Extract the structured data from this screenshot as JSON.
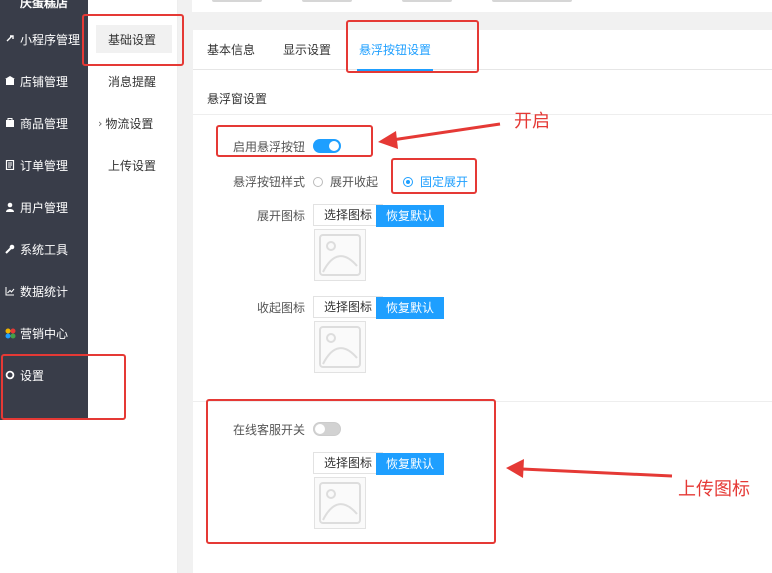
{
  "sidebar": {
    "brand": "庆蛋糕店",
    "items": [
      {
        "label": "小程序管理",
        "icon": "link-icon"
      },
      {
        "label": "店铺管理",
        "icon": "store-icon"
      },
      {
        "label": "商品管理",
        "icon": "goods-icon"
      },
      {
        "label": "订单管理",
        "icon": "order-icon"
      },
      {
        "label": "用户管理",
        "icon": "user-icon"
      },
      {
        "label": "系统工具",
        "icon": "wrench-icon"
      },
      {
        "label": "数据统计",
        "icon": "chart-icon"
      },
      {
        "label": "营销中心",
        "icon": "marketing-icon"
      },
      {
        "label": "设置",
        "icon": "gear-icon"
      }
    ]
  },
  "submenu": {
    "items": [
      {
        "label": "基础设置",
        "active": true
      },
      {
        "label": "消息提醒"
      },
      {
        "label": "物流设置",
        "expandable": true
      },
      {
        "label": "上传设置"
      }
    ]
  },
  "tabs": [
    "基本信息",
    "显示设置",
    "悬浮按钮设置"
  ],
  "active_tab": "悬浮按钮设置",
  "form": {
    "section_title": "悬浮窗设置",
    "enable_label": "启用悬浮按钮",
    "enable_on": true,
    "style_label": "悬浮按钮样式",
    "style_options": [
      "展开收起",
      "固定展开"
    ],
    "style_selected": "固定展开",
    "expand_icon_label": "展开图标",
    "collapse_icon_label": "收起图标",
    "choose_icon": "选择图标",
    "reset_default": "恢复默认",
    "online_service_label": "在线客服开关",
    "online_service_on": false
  },
  "annotations": {
    "open_note": "开启",
    "upload_note": "上传图标"
  },
  "colors": {
    "accent": "#1e9fff",
    "sidebar_bg": "#393d49",
    "annotation_red": "#e53935"
  }
}
